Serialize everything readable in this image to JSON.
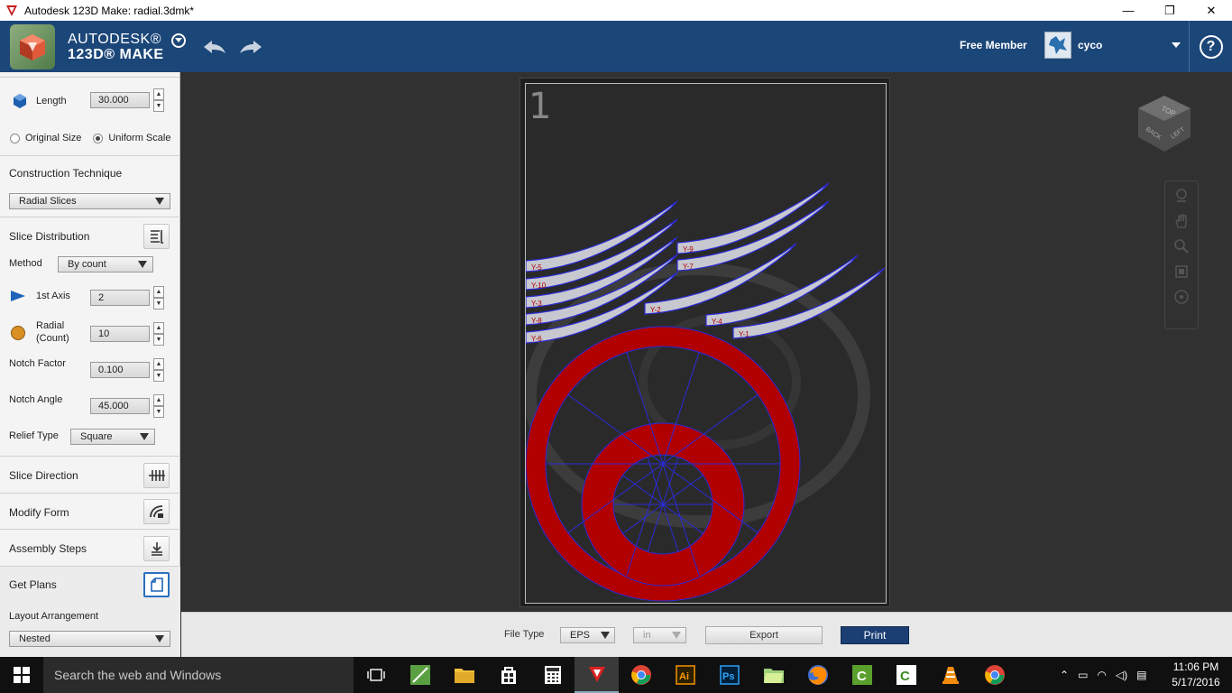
{
  "window": {
    "title": "Autodesk 123D Make: radial.3dmk*",
    "minimize": "—",
    "maximize": "❐",
    "close": "✕"
  },
  "header": {
    "brand_line1": "AUTODESK®",
    "brand_line2": "123D® MAKE",
    "member": "Free Member",
    "username": "cyco",
    "help": "?"
  },
  "sidebar": {
    "length_label": "Length",
    "length_value": "30.000",
    "original_size_label": "Original Size",
    "uniform_scale_label": "Uniform Scale",
    "construction_title": "Construction Technique",
    "construction_value": "Radial Slices",
    "distribution_title": "Slice Distribution",
    "method_label": "Method",
    "method_value": "By count",
    "axis1_label": "1st Axis",
    "axis1_value": "2",
    "radial_label_1": "Radial",
    "radial_label_2": "(Count)",
    "radial_value": "10",
    "notch_factor_label": "Notch Factor",
    "notch_factor_value": "0.100",
    "notch_angle_label": "Notch Angle",
    "notch_angle_value": "45.000",
    "relief_label": "Relief Type",
    "relief_value": "Square",
    "slice_direction_title": "Slice Direction",
    "modify_form_title": "Modify Form",
    "assembly_title": "Assembly Steps",
    "get_plans_title": "Get Plans",
    "layout_label": "Layout Arrangement",
    "layout_value": "Nested"
  },
  "canvas": {
    "page_number": "1",
    "pieces": [
      "Y-5",
      "Y-10",
      "Y-3",
      "Y-8",
      "Y-6",
      "Y-9",
      "Y-7",
      "Y-2",
      "Y-4",
      "Y-1"
    ],
    "viewcube_labels": [
      "TOP",
      "BACK",
      "LEFT"
    ],
    "colors": {
      "slice_fill": "#c8c8d0",
      "slice_edge": "#2b2bd8",
      "ring_fill": "#b00000"
    }
  },
  "bottombar": {
    "file_type_label": "File Type",
    "file_type_value": "EPS",
    "unit_value": "in",
    "export_label": "Export",
    "print_label": "Print"
  },
  "taskbar": {
    "search_placeholder": "Search the web and Windows",
    "time": "11:06 PM",
    "date": "5/17/2016"
  }
}
